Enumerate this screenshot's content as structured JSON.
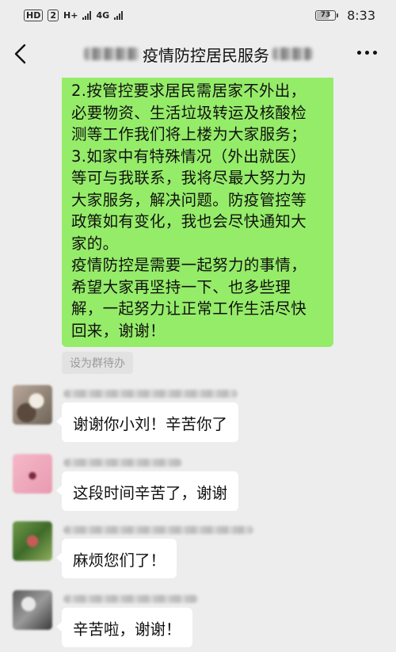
{
  "status_bar": {
    "hd_badge": "HD",
    "sim_badge": "2",
    "network_1": "H+",
    "network_2": "4G",
    "battery": "73",
    "battery_level": 0.73,
    "time": "8:33"
  },
  "nav": {
    "title": "疫情防控居民服务",
    "icons": [
      "back-arrow-icon",
      "more-icon"
    ]
  },
  "sent_message": {
    "lines": [
      "2.按管控要求居民需居家不外出，",
      "必要物资、生活垃圾转运及核酸检",
      "测等工作我们将上楼为大家服务；",
      "3.如家中有特殊情况（外出就医）",
      "等可与我联系，我将尽最大努力为",
      "大家服务，解决问题。防疫管控等",
      "政策如有变化，我也会尽快通知大",
      "家的。",
      "疫情防控是需要一起努力的事情，",
      "希望大家再坚持一下、也多些理",
      "解，一起努力让正常工作生活尽快",
      "回来，谢谢！"
    ],
    "bubble_color": "#95ec69"
  },
  "todo_tag": "设为群待办",
  "messages": [
    {
      "text": "谢谢你小刘！辛苦你了"
    },
    {
      "text": "这段时间辛苦了，谢谢"
    },
    {
      "text": "麻烦您们了！"
    },
    {
      "text": "辛苦啦，谢谢！"
    }
  ],
  "colors": {
    "background": "#ededed",
    "sent_bubble": "#95ec69",
    "received_bubble": "#ffffff"
  }
}
